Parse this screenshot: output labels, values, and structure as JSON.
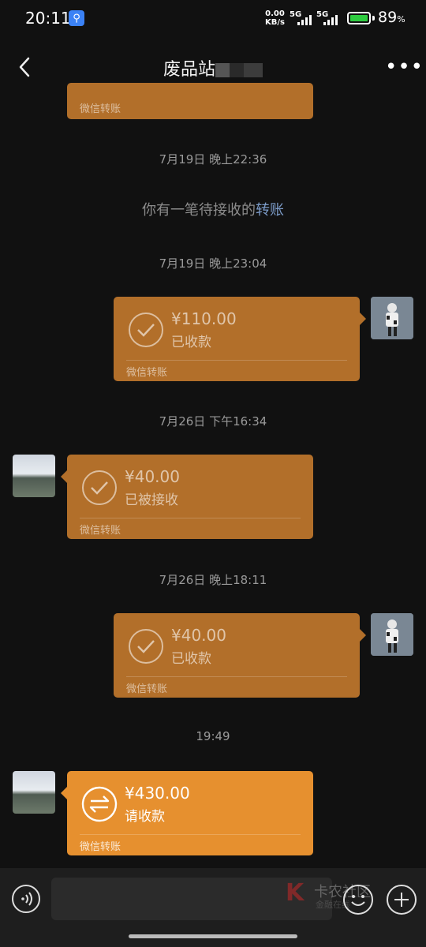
{
  "status_bar": {
    "time": "20:11",
    "net_speed": "0.00",
    "net_unit": "KB/s",
    "sim1": "5G",
    "sim2": "5G",
    "battery_percent": "89",
    "battery_unit": "%"
  },
  "header": {
    "title": "废品站",
    "more": "•••"
  },
  "messages": {
    "top_card_footer": "微信转账",
    "ts1": "7月19日 晚上22:36",
    "system_prefix": "你有一笔待接收的",
    "system_link": "转账",
    "ts2": "7月19日 晚上23:04",
    "card1": {
      "amount": "¥110.00",
      "state": "已收款",
      "footer": "微信转账"
    },
    "ts3": "7月26日 下午16:34",
    "card2": {
      "amount": "¥40.00",
      "state": "已被接收",
      "footer": "微信转账"
    },
    "ts4": "7月26日 晚上18:11",
    "card3": {
      "amount": "¥40.00",
      "state": "已收款",
      "footer": "微信转账"
    },
    "ts5": "19:49",
    "card4": {
      "amount": "¥430.00",
      "state": "请收款",
      "footer": "微信转账"
    }
  },
  "watermark": {
    "brand": "卡农社区",
    "sub": "金融在线"
  },
  "colors": {
    "background": "#111111",
    "card_received": "#b26f2a",
    "card_pending": "#e6902f",
    "link": "#7c9cc9"
  }
}
